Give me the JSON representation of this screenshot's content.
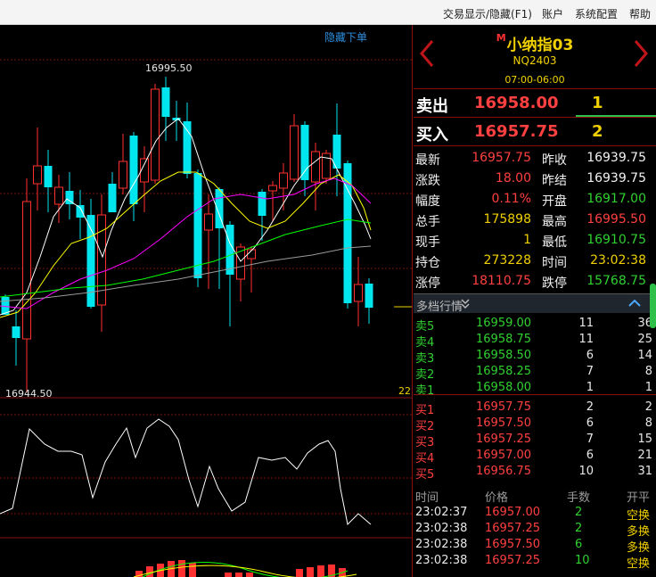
{
  "menu": [
    "交易显示/隐藏(F1)",
    "账户",
    "系统配置",
    "帮助"
  ],
  "chart": {
    "hide_order_label": "隐藏下单",
    "high_label": "16995.50",
    "low_label": "16944.50",
    "count_label": "22",
    "colors": {
      "up": "#ff3030",
      "down": "#00e5ee",
      "ma1": "#ffffff",
      "ma2": "#ffff00",
      "ma3": "#ff00ff",
      "ma4": "#00ff00",
      "ma5": "#9a9a9a"
    }
  },
  "contract": {
    "name": "小纳指03",
    "mark": "M",
    "code": "NQ2403",
    "hours": "07:00-06:00"
  },
  "book": {
    "sell_label": "卖出",
    "sell_price": "16958.00",
    "sell_vol": "1",
    "buy_label": "买入",
    "buy_price": "16957.75",
    "buy_vol": "2"
  },
  "quote": [
    {
      "l1": "最新",
      "v1": "16957.75",
      "c1": "#ff4040",
      "l2": "昨收",
      "v2": "16939.75",
      "c2": "#f2f2f2"
    },
    {
      "l1": "涨跌",
      "v1": "18.00",
      "c1": "#ff4040",
      "l2": "昨结",
      "v2": "16939.75",
      "c2": "#f2f2f2"
    },
    {
      "l1": "幅度",
      "v1": "0.11%",
      "c1": "#ff4040",
      "l2": "开盘",
      "v2": "16917.00",
      "c2": "#30d030"
    },
    {
      "l1": "总手",
      "v1": "175898",
      "c1": "#f0d000",
      "l2": "最高",
      "v2": "16995.50",
      "c2": "#ff4040"
    },
    {
      "l1": "现手",
      "v1": "1",
      "c1": "#f0d000",
      "l2": "最低",
      "v2": "16910.75",
      "c2": "#30d030"
    },
    {
      "l1": "持仓",
      "v1": "273228",
      "c1": "#f0d000",
      "l2": "时间",
      "v2": "23:02:38",
      "c2": "#f0d000"
    },
    {
      "l1": "涨停",
      "v1": "18110.75",
      "c1": "#ff4040",
      "l2": "跌停",
      "v2": "15768.75",
      "c2": "#30d030"
    }
  ],
  "depth": {
    "title": "多档行情",
    "asks": [
      {
        "label": "卖5",
        "price": "16959.00",
        "vol": "11",
        "num": "36"
      },
      {
        "label": "卖4",
        "price": "16958.75",
        "vol": "11",
        "num": "25"
      },
      {
        "label": "卖3",
        "price": "16958.50",
        "vol": "6",
        "num": "14"
      },
      {
        "label": "卖2",
        "price": "16958.25",
        "vol": "7",
        "num": "8"
      },
      {
        "label": "卖1",
        "price": "16958.00",
        "vol": "1",
        "num": "1"
      }
    ],
    "bids": [
      {
        "label": "买1",
        "price": "16957.75",
        "vol": "2",
        "num": "2"
      },
      {
        "label": "买2",
        "price": "16957.50",
        "vol": "6",
        "num": "8"
      },
      {
        "label": "买3",
        "price": "16957.25",
        "vol": "7",
        "num": "15"
      },
      {
        "label": "买4",
        "price": "16957.00",
        "vol": "6",
        "num": "21"
      },
      {
        "label": "买5",
        "price": "16956.75",
        "vol": "10",
        "num": "31"
      }
    ]
  },
  "ticks": {
    "headers": [
      "时间",
      "价格",
      "手数",
      "开平"
    ],
    "rows": [
      {
        "time": "23:02:37",
        "price": "16957.00",
        "vol": "2",
        "type": "空换"
      },
      {
        "time": "23:02:38",
        "price": "16957.25",
        "vol": "2",
        "type": "多换"
      },
      {
        "time": "23:02:38",
        "price": "16957.50",
        "vol": "6",
        "type": "多换"
      },
      {
        "time": "23:02:38",
        "price": "16957.25",
        "vol": "10",
        "type": "空换"
      }
    ]
  }
}
